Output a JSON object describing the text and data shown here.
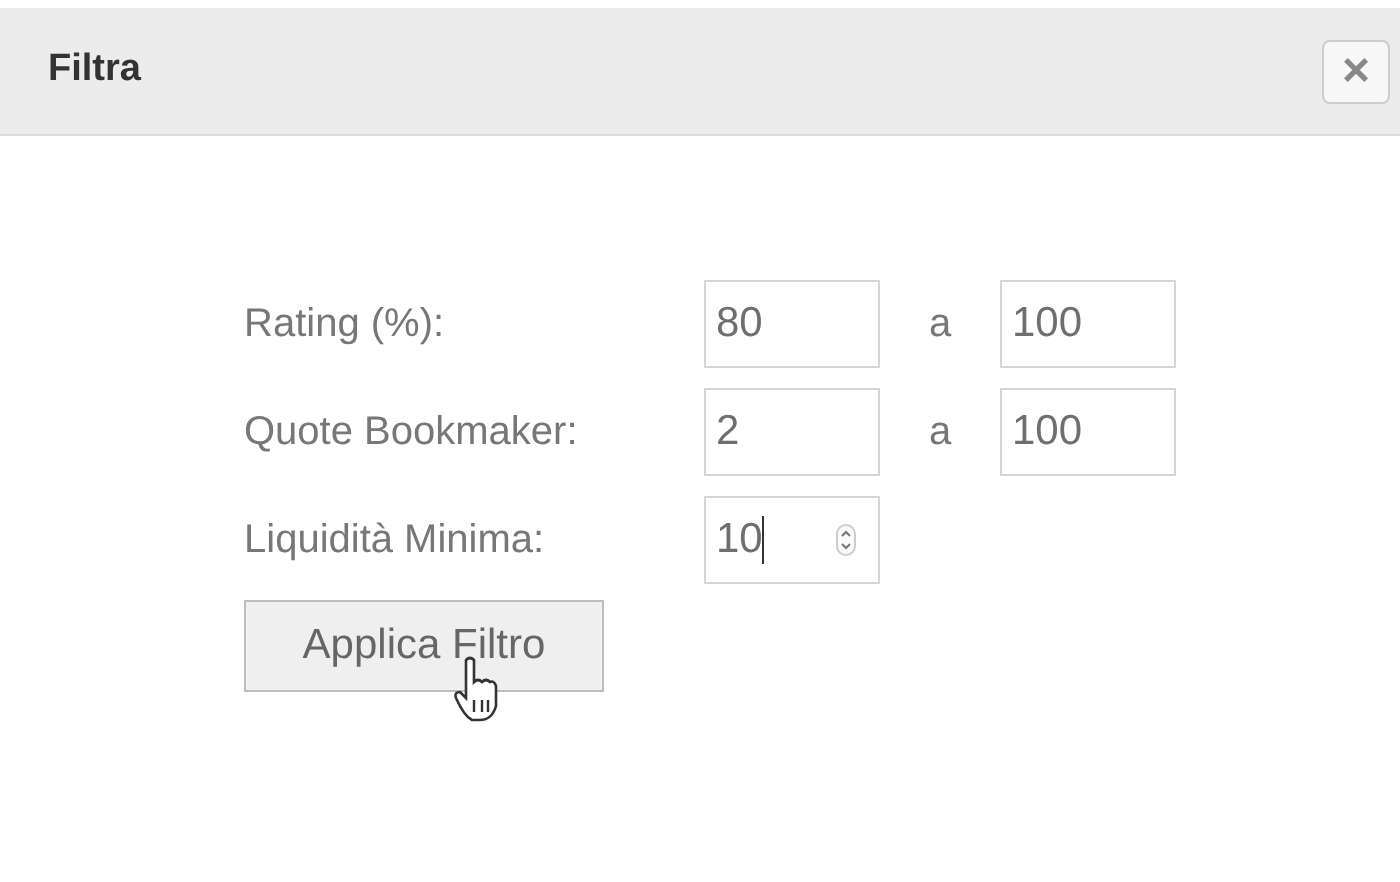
{
  "dialog": {
    "title": "Filtra",
    "close_label": "×"
  },
  "rows": [
    {
      "kind": "range",
      "label": "Rating (%):",
      "from": "80",
      "separator": "a",
      "to": "100"
    },
    {
      "kind": "range",
      "label": "Quote Bookmaker:",
      "from": "2",
      "separator": "a",
      "to": "100"
    },
    {
      "kind": "number",
      "label": "Liquidità Minima:",
      "value": "10",
      "focused": true
    }
  ],
  "button": {
    "label": "Applica Filtro"
  }
}
